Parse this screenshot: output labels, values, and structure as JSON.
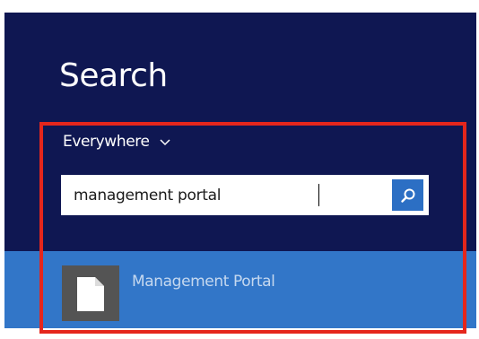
{
  "search_pane": {
    "title": "Search",
    "scope": {
      "label": "Everywhere",
      "icon": "chevron-down-icon"
    },
    "search_box": {
      "value": "management portal",
      "button_icon": "search-icon"
    },
    "results": [
      {
        "label": "Management Portal",
        "icon": "document-icon"
      }
    ]
  },
  "colors": {
    "pane_background": "#0f1752",
    "selected_result_background": "#3276c8",
    "search_button": "#2c6fc4",
    "highlight_border": "#e5261c"
  }
}
